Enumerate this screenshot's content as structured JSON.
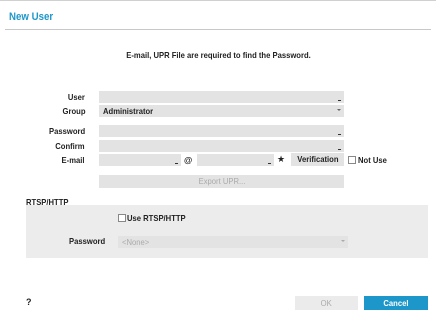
{
  "dialog": {
    "title": "New User",
    "notice": "E-mail, UPR File are required to find the Password."
  },
  "form": {
    "user_label": "User",
    "user_value": "",
    "group_label": "Group",
    "group_value": "Administrator",
    "password_label": "Password",
    "password_value": "",
    "confirm_label": "Confirm",
    "confirm_value": "",
    "email_label": "E-mail",
    "email_local": "",
    "email_at": "@",
    "email_domain": "",
    "verification_label": "Verification",
    "not_use_label": "Not Use",
    "export_upr_label": "Export UPR..."
  },
  "rtsp": {
    "section_title": "RTSP/HTTP",
    "use_label": "Use RTSP/HTTP",
    "password_label": "Password",
    "password_value": "<None>"
  },
  "footer": {
    "help_label": "?",
    "ok_label": "OK",
    "cancel_label": "Cancel"
  },
  "icons": {
    "star": "star-icon",
    "chevron": "chevron-down-icon"
  },
  "colors": {
    "accent": "#1d97c9",
    "field_bg": "#e3e3e3",
    "section_bg": "#ececec"
  }
}
